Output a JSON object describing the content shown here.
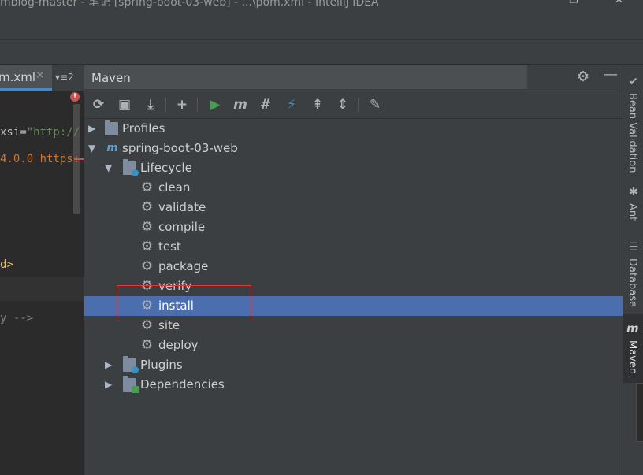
{
  "window": {
    "title": "mblog-master - 笔记 [spring-boot-03-web] - ...\\pom.xml - IntelliJ IDEA"
  },
  "editor": {
    "tab_label": "m.xml",
    "tab_close": "✕",
    "tabs_menu": "▾≡2",
    "lines": {
      "xsi_attr": "xsi=",
      "xsi_val": "\"http://",
      "schema": "4.0.0 https:",
      "tag_tail": "d>",
      "comment_tail": "y -->"
    }
  },
  "maven_panel": {
    "title": "Maven",
    "settings_icon": "gear-icon",
    "minimize_icon": "minimize-icon",
    "toolbar": [
      {
        "name": "reimport-icon",
        "glyph": "⟳"
      },
      {
        "name": "generate-sources-icon",
        "glyph": "▣"
      },
      {
        "name": "download-icon",
        "glyph": "⤓"
      },
      {
        "name": "add-icon",
        "glyph": "+"
      },
      {
        "name": "run-icon",
        "glyph": "▶"
      },
      {
        "name": "execute-goal-icon",
        "glyph": "m"
      },
      {
        "name": "skip-tests-icon",
        "glyph": "#"
      },
      {
        "name": "offline-icon",
        "glyph": "⚡"
      },
      {
        "name": "show-dependencies-icon",
        "glyph": "⇞"
      },
      {
        "name": "collapse-all-icon",
        "glyph": "⇕"
      },
      {
        "name": "maven-settings-icon",
        "glyph": "✎"
      }
    ],
    "tree": {
      "profiles": "Profiles",
      "project": "spring-boot-03-web",
      "lifecycle": "Lifecycle",
      "goals": [
        "clean",
        "validate",
        "compile",
        "test",
        "package",
        "verify",
        "install",
        "site",
        "deploy"
      ],
      "selected_goal": "install",
      "plugins": "Plugins",
      "dependencies": "Dependencies"
    }
  },
  "right_strip": {
    "items": [
      "Bean Validation",
      "Ant",
      "Database",
      "Maven"
    ],
    "active": "Maven"
  },
  "colors": {
    "selection": "#4b6eaf",
    "highlight_box": "#e0383b",
    "run_green": "#499c54",
    "accent_blue": "#3592c4"
  }
}
